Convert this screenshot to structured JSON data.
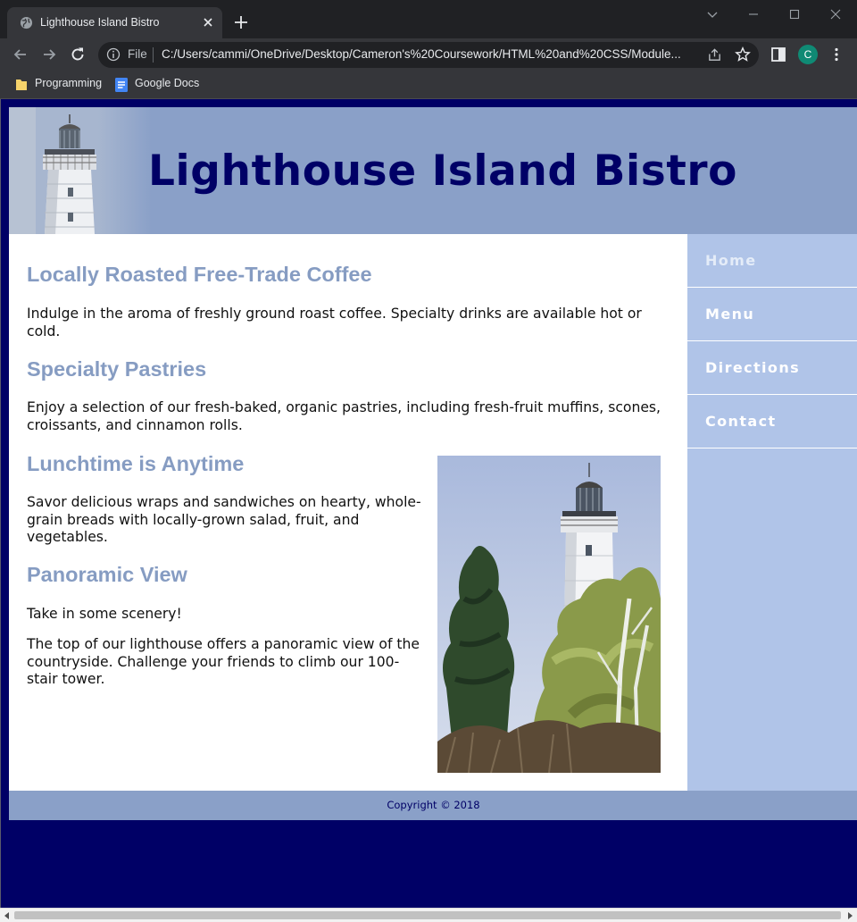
{
  "browser": {
    "tab_title": "Lighthouse Island Bistro",
    "omnibox_scheme": "File",
    "url": "C:/Users/cammi/OneDrive/Desktop/Cameron's%20Coursework/HTML%20and%20CSS/Module...",
    "profile_initial": "C",
    "bookmarks": [
      "Programming",
      "Google Docs"
    ],
    "icons": [
      "globe-icon",
      "close-icon",
      "plus-icon",
      "chevron-down-icon",
      "minimize-icon",
      "maximize-icon",
      "window-close-icon",
      "back-icon",
      "forward-icon",
      "reload-icon",
      "info-icon",
      "share-icon",
      "star-icon",
      "side-panel-icon",
      "more-icon",
      "folder-icon",
      "docs-icon"
    ]
  },
  "site": {
    "title": "Lighthouse Island Bistro",
    "nav": [
      "Home",
      "Menu",
      "Directions",
      "Contact"
    ],
    "sections": {
      "coffee": {
        "heading": "Locally Roasted Free-Trade Coffee",
        "text": "Indulge in the aroma of freshly ground roast coffee. Specialty drinks are available hot or cold."
      },
      "pastries": {
        "heading": "Specialty Pastries",
        "text": "Enjoy a selection of our fresh-baked, organic pastries, including fresh-fruit muffins, scones, croissants, and cinnamon rolls."
      },
      "lunch": {
        "heading": "Lunchtime is Anytime",
        "text": "Savor delicious wraps and sandwiches on hearty, whole-grain breads with locally-grown salad, fruit, and vegetables."
      },
      "view": {
        "heading": "Panoramic View",
        "text1": "Take in some scenery!",
        "text2": "The top of our lighthouse offers a panoramic view of the countryside. Challenge your friends to climb our 100-stair tower."
      }
    },
    "footer": "Copyright © 2018"
  },
  "colors": {
    "page_bg": "#000066",
    "header_bg": "#8aa0c8",
    "nav_bg": "#b0c4e8",
    "heading": "#869cc2",
    "title": "#000066"
  }
}
